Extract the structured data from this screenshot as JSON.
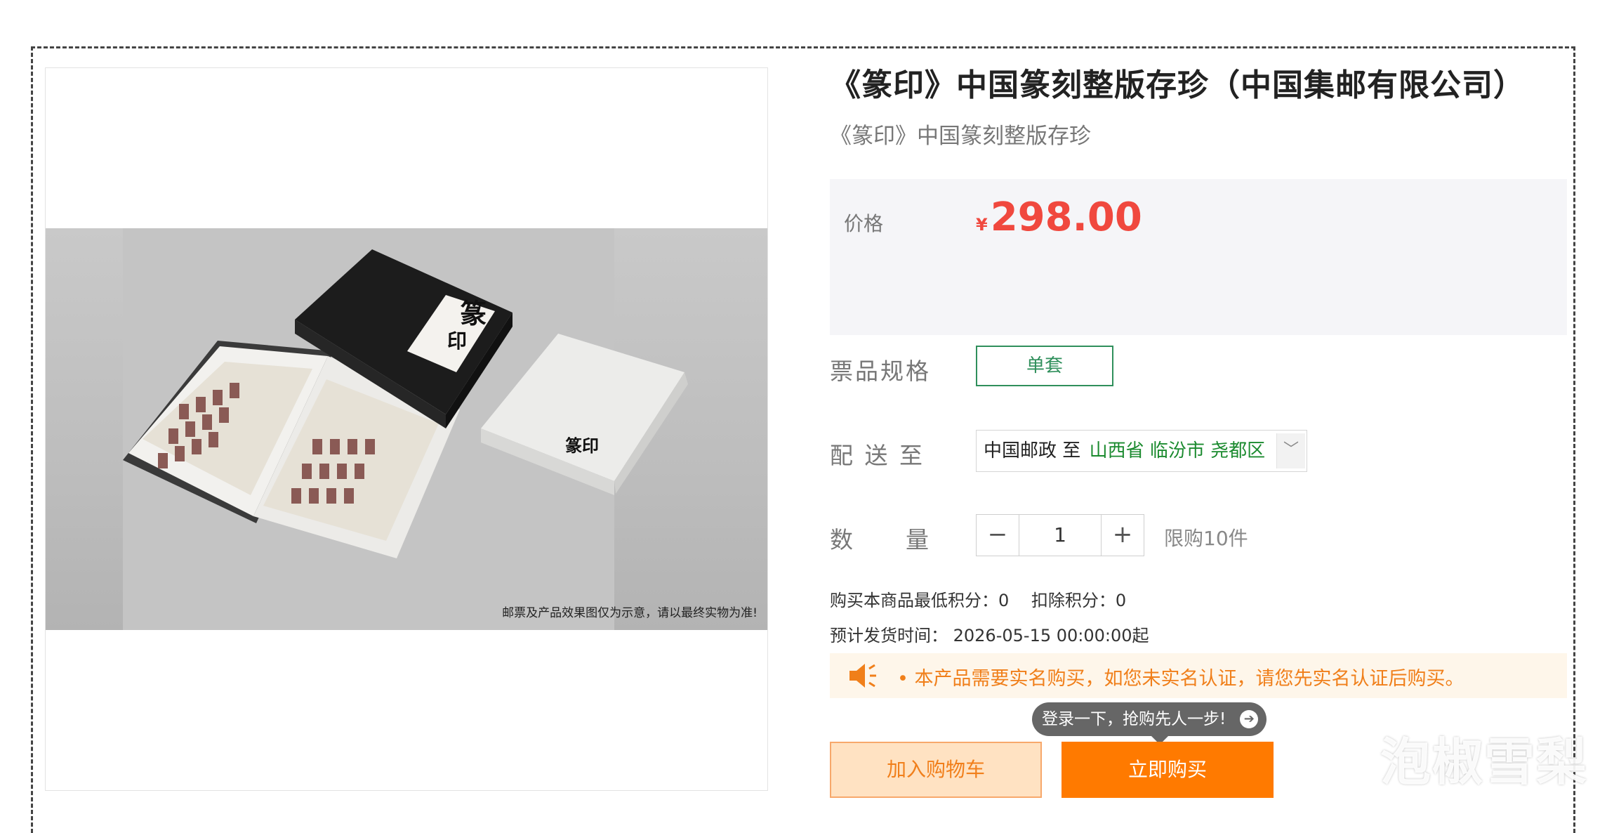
{
  "product": {
    "title": "《篆印》中国篆刻整版存珍（中国集邮有限公司）",
    "subtitle": "《篆印》中国篆刻整版存珍",
    "image_disclaimer": "邮票及产品效果图仅为示意，请以最终实物为准!",
    "image_text_box1": "篆",
    "image_text_box2": "印",
    "image_text_box3": "篆印"
  },
  "price": {
    "label": "价格",
    "currency": "¥",
    "amount": "298.00",
    "color": "#f0483e"
  },
  "spec": {
    "label": "票品规格",
    "option": "单套"
  },
  "shipping": {
    "label": "配 送 至",
    "carrier": "中国邮政",
    "to": "至",
    "region": "山西省 临汾市 尧都区"
  },
  "quantity": {
    "label": "数　　量",
    "minus": "−",
    "value": "1",
    "plus": "+",
    "limit": "限购10件"
  },
  "points": {
    "text": "购买本商品最低积分：0　 扣除积分：0"
  },
  "delivery": {
    "text": "预计发货时间：  2026-05-15 00:00:00起"
  },
  "notice": {
    "text": "• 本产品需要实名购买，如您未实名认证，请您先实名认证后购买。"
  },
  "login_tip": {
    "text": "登录一下，抢购先人一步!",
    "icon": "arrow-right-circle-icon"
  },
  "actions": {
    "add_to_cart": "加入购物车",
    "buy_now": "立即购买"
  },
  "watermark": "泡椒雪梨",
  "colors": {
    "accent_orange": "#ff7a00",
    "spec_green": "#2f8f5b",
    "region_green": "#1a8a2e"
  }
}
